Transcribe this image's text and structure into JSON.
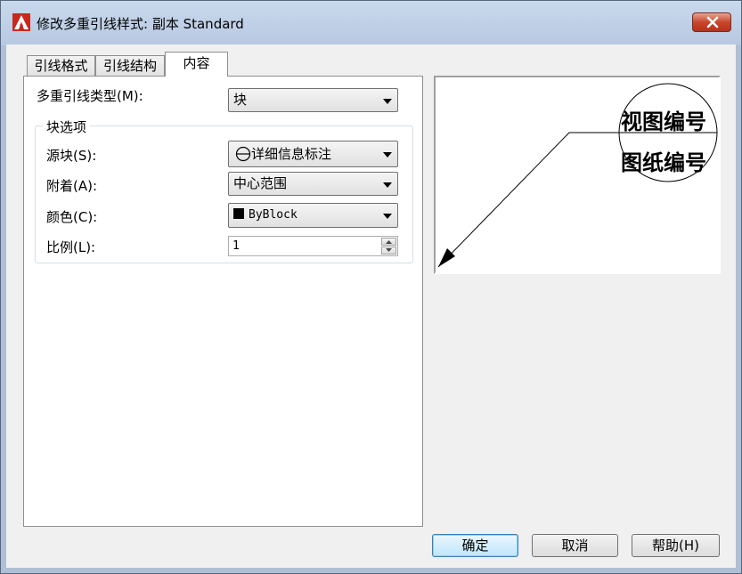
{
  "window": {
    "title": "修改多重引线样式: 副本 Standard",
    "app_icon": "autocad-icon",
    "close_icon": "close-icon"
  },
  "tabs": [
    {
      "label": "引线格式",
      "active": false
    },
    {
      "label": "引线结构",
      "active": false
    },
    {
      "label": "内容",
      "active": true
    }
  ],
  "content": {
    "leader_type_label": "多重引线类型(M):",
    "leader_type_value": "块",
    "block_options_title": "块选项",
    "source_block_label": "源块(S):",
    "source_block_value": "详细信息标注",
    "source_block_icon": "circle-block-icon",
    "attachment_label": "附着(A):",
    "attachment_value": "中心范围",
    "color_label": "颜色(C):",
    "color_value": "ByBlock",
    "color_swatch": "#000000",
    "scale_label": "比例(L):",
    "scale_value": "1"
  },
  "preview": {
    "line1": "视图编号",
    "line2": "图纸编号"
  },
  "buttons": {
    "ok": "确定",
    "cancel": "取消",
    "help": "帮助(H)"
  }
}
